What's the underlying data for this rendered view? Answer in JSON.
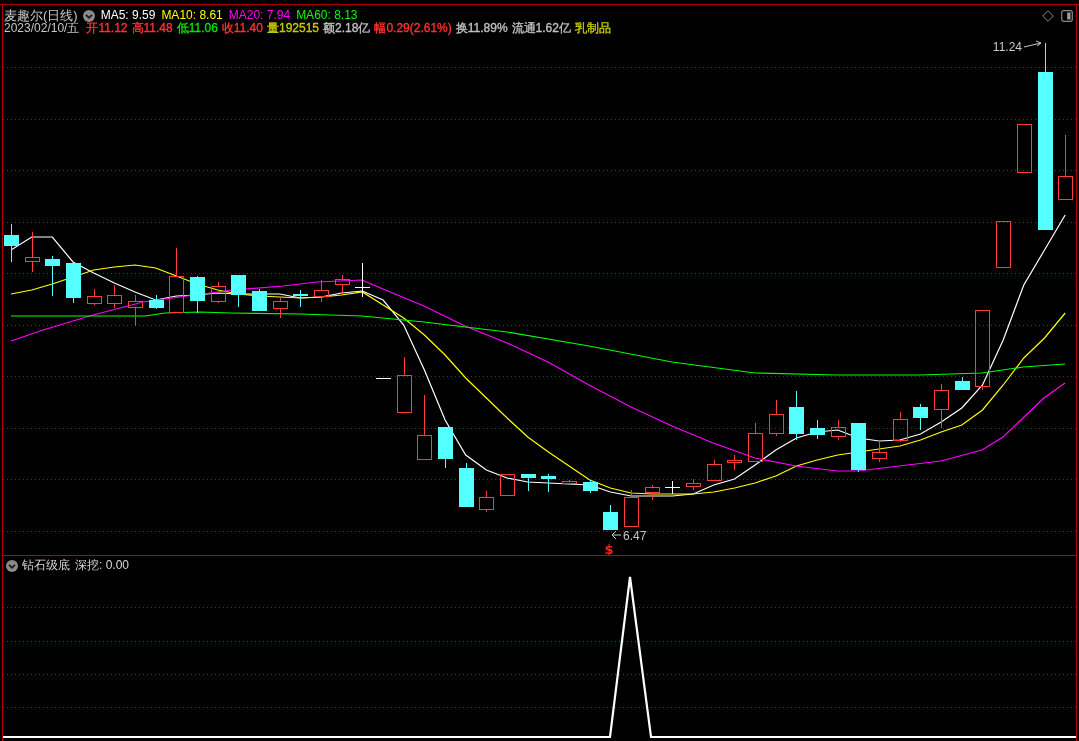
{
  "header": {
    "title": "麦趣尔(日线)",
    "moving_averages": [
      {
        "label": "MA5: 9.59",
        "color": "#ffffff"
      },
      {
        "label": "MA10: 8.61",
        "color": "#ffff00"
      },
      {
        "label": "MA20: 7.94",
        "color": "#ff00ff"
      },
      {
        "label": "MA60: 8.13",
        "color": "#00ff00"
      }
    ]
  },
  "quote": {
    "date": "2023/02/10/五",
    "fields": [
      {
        "text": "开11.12",
        "color": "#ff3232"
      },
      {
        "text": "高11.48",
        "color": "#ff3232"
      },
      {
        "text": "低11.06",
        "color": "#00e600"
      },
      {
        "text": "收11.40",
        "color": "#ff3232"
      },
      {
        "text": "量192515",
        "color": "#c8c800"
      },
      {
        "text": "额2.18亿",
        "color": "#c0c0c0"
      },
      {
        "text": "幅0.29(2.61%)",
        "color": "#ff3232"
      },
      {
        "text": "换11.89%",
        "color": "#c0c0c0"
      },
      {
        "text": "流通1.62亿",
        "color": "#c0c0c0"
      },
      {
        "text": "乳制品",
        "color": "#c8c800"
      }
    ]
  },
  "price_chart": {
    "high_marker": "11.24",
    "low_marker": "6.47",
    "signal_mark": "$"
  },
  "indicator_panel": {
    "name": "钻石级底",
    "readout": "深挖: 0.00"
  }
}
